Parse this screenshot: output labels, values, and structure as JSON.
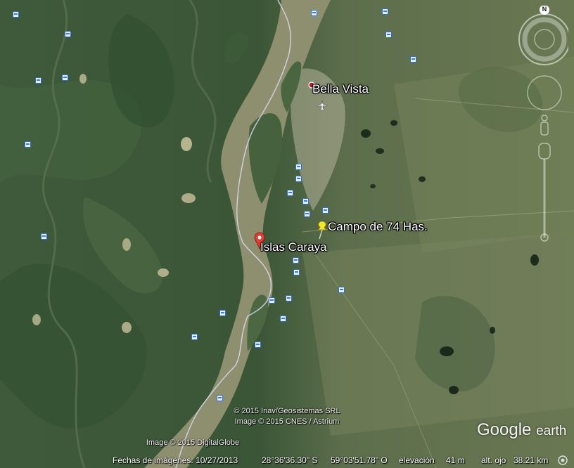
{
  "places": {
    "bella_vista": "Bella Vista",
    "campo": "Campo de 74 Has.",
    "islas": "Islas Caraya"
  },
  "attribution": {
    "line1": "© 2015 Inav/Geosistemas SRL",
    "line2": "Image © 2015 CNES / Astrium",
    "line3": "Image © 2015 DigitalGlobe"
  },
  "status": {
    "dates_label": "Fechas de imágenes: 10/27/2013",
    "latitude": "28°36'36.30\" S",
    "longitude": "59°03'51.78\" O",
    "elevation_label": "elevación",
    "elevation_value": "41 m",
    "eye_alt_label": "alt. ojo",
    "eye_alt_value": "38.21 km"
  },
  "logo": {
    "google": "Google",
    "earth": "earth"
  },
  "compass": {
    "north": "N"
  },
  "colors": {
    "river": "#8e8f6f",
    "vegetation_dark": "#2f4a2e",
    "vegetation_light": "#6d7d55",
    "pin_red": "#e23b2f",
    "pin_yellow": "#f4e52a",
    "border_line": "#d8dcf0"
  }
}
